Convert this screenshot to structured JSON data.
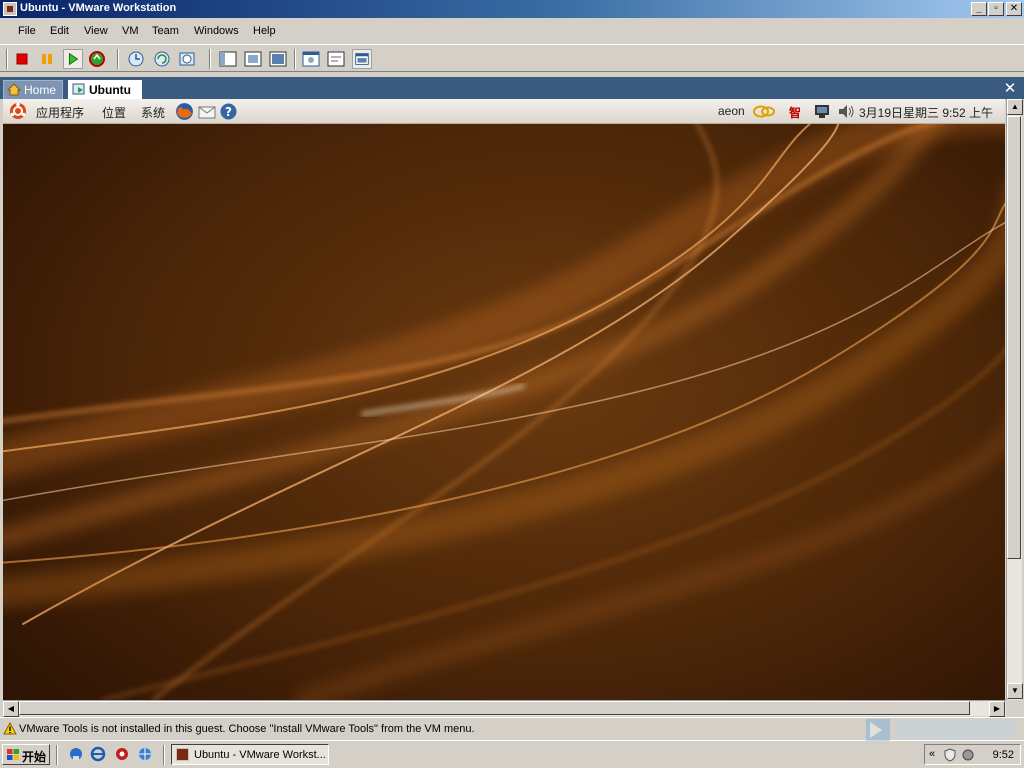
{
  "window": {
    "title": "Ubuntu - VMware Workstation"
  },
  "menu": [
    "File",
    "Edit",
    "View",
    "VM",
    "Team",
    "Windows",
    "Help"
  ],
  "toolbar": {
    "icons": [
      "power-off-icon",
      "suspend-icon",
      "power-on-icon",
      "reset-icon",
      "snapshot-icon",
      "revert-snapshot-icon",
      "snapshot-manager-icon",
      "sidebar-view-icon",
      "full-screen-icon",
      "quick-switch-icon",
      "summary-view-icon",
      "console-view-icon",
      "tabs-view-icon"
    ]
  },
  "tabs": [
    {
      "label": "Home",
      "active": false
    },
    {
      "label": "Ubuntu",
      "active": true
    }
  ],
  "gnome_panel": {
    "menus": [
      "应用程序",
      "位置",
      "系统"
    ],
    "user": "aeon",
    "ime_label": "智",
    "datetime": "3月19日星期三  9:52 上午"
  },
  "status": {
    "message": "VMware Tools is not installed in this guest. Choose \"Install VMware Tools\" from the VM menu."
  },
  "taskbar": {
    "start_label": "开始",
    "tasks": [
      {
        "label": "Ubuntu - VMware Workst..."
      }
    ],
    "clock": "9:52"
  },
  "colors": {
    "titlebar": "#0a246a",
    "desktop": "#4a2508",
    "tab_bar": "#3a5a80"
  }
}
